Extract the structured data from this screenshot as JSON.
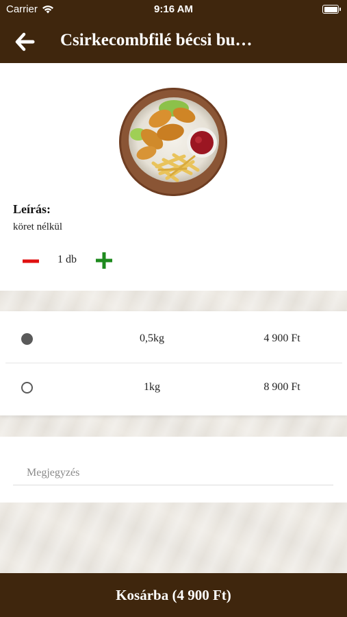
{
  "status_bar": {
    "carrier": "Carrier",
    "time": "9:16 AM"
  },
  "header": {
    "title": "Csirkecombfilé bécsi bu…"
  },
  "product": {
    "description_label": "Leírás:",
    "description": "köret nélkül",
    "quantity_text": "1 db"
  },
  "options": [
    {
      "size": "0,5kg",
      "price": "4 900 Ft",
      "selected": true
    },
    {
      "size": "1kg",
      "price": "8 900 Ft",
      "selected": false
    }
  ],
  "note": {
    "placeholder": "Megjegyzés",
    "value": ""
  },
  "cart": {
    "label": "Kosárba (4 900 Ft)"
  },
  "colors": {
    "brand": "#3f260d",
    "minus": "#e01010",
    "plus": "#1e8a1e",
    "radio": "#5a5a5a"
  },
  "icons": [
    "wifi-icon",
    "battery-icon",
    "back-arrow-icon",
    "minus-icon",
    "plus-icon",
    "radio-selected-icon",
    "radio-unselected-icon"
  ]
}
